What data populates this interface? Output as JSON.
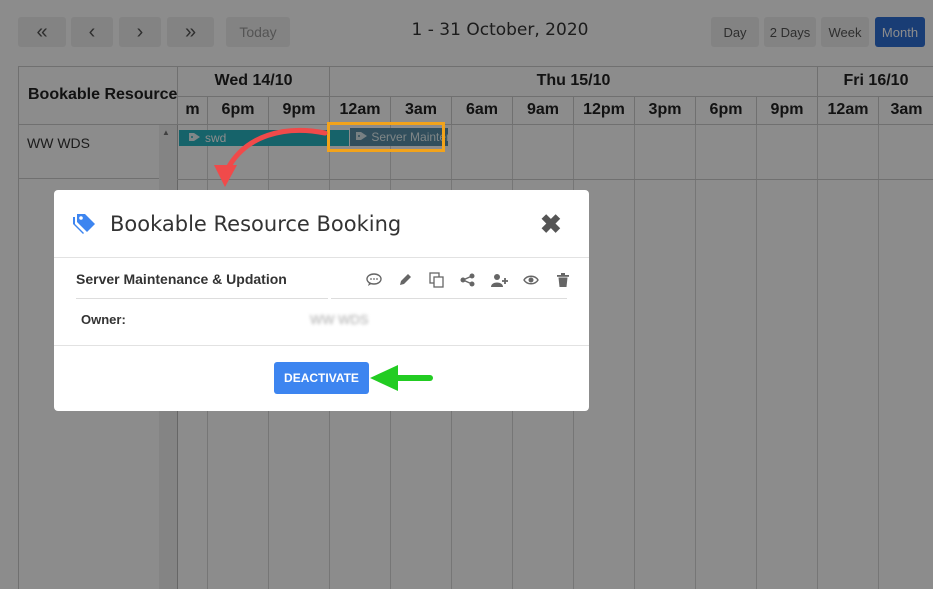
{
  "toolbar": {
    "nav": {
      "first": "«",
      "prev": "‹",
      "next": "›",
      "last": "»"
    },
    "today_label": "Today",
    "date_range": "1 - 31 October, 2020",
    "views": [
      "Day",
      "2 Days",
      "Week",
      "Month"
    ],
    "active_view": "Month"
  },
  "grid": {
    "resource_header": "Bookable Resources",
    "resources": [
      "WW WDS"
    ],
    "days": [
      "Wed 14/10",
      "Thu 15/10",
      "Fri 16/10"
    ],
    "hours": [
      "m",
      "6pm",
      "9pm",
      "12am",
      "3am",
      "6am",
      "9am",
      "12pm",
      "3pm",
      "6pm",
      "9pm",
      "12am",
      "3am"
    ],
    "events": [
      {
        "label": "swd",
        "color": "#29b5c2"
      },
      {
        "label": "Server Maintenance & Updation",
        "color": "#5a8fa8"
      }
    ]
  },
  "modal": {
    "title": "Bookable Resource Booking",
    "booking_name": "Server Maintenance & Updation",
    "owner_label": "Owner:",
    "owner_value": "WW WDS",
    "deactivate_label": "DEACTIVATE",
    "icons": [
      "comment-icon",
      "edit-icon",
      "copy-icon",
      "share-icon",
      "add-user-icon",
      "view-icon",
      "delete-icon"
    ]
  },
  "colors": {
    "accent": "#3d85f0",
    "highlight": "#f2a31b",
    "annotation_red": "#f04a4a",
    "annotation_green": "#22cc22"
  }
}
